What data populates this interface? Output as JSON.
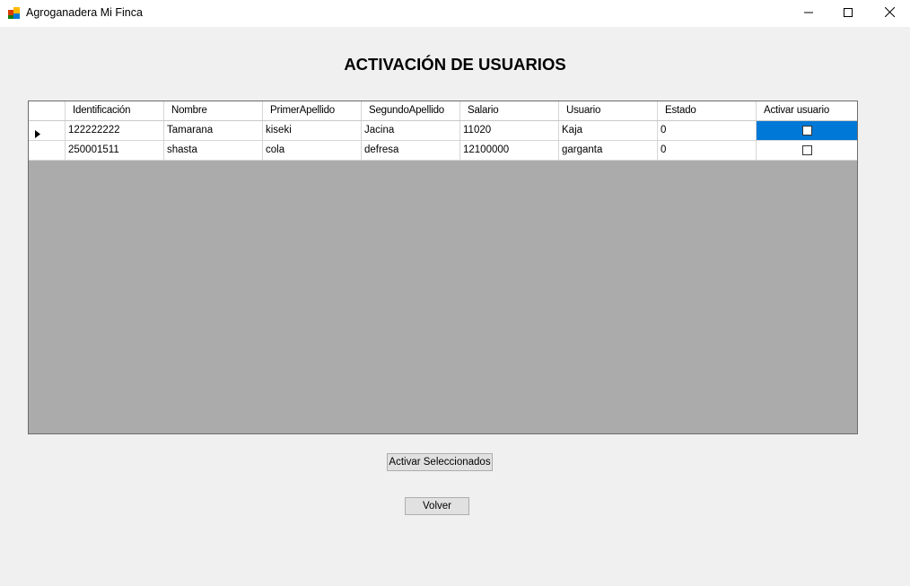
{
  "window": {
    "title": "Agroganadera Mi Finca",
    "controls": {
      "minimize_icon": "minimize-icon",
      "maximize_icon": "maximize-icon",
      "close_icon": "close-icon"
    }
  },
  "page": {
    "heading": "ACTIVACIÓN DE USUARIOS"
  },
  "table": {
    "columns": [
      "Identificación",
      "Nombre",
      "PrimerApellido",
      "SegundoApellido",
      "Salario",
      "Usuario",
      "Estado",
      "Activar usuario"
    ],
    "rows": [
      {
        "identificacion": "122222222",
        "nombre": "Tamarana",
        "primer_apellido": "kiseki",
        "segundo_apellido": "Jacina",
        "salario": "11020",
        "usuario": "Kaja",
        "estado": "0",
        "activar": false,
        "current": true
      },
      {
        "identificacion": "250001511",
        "nombre": "shasta",
        "primer_apellido": "cola",
        "segundo_apellido": "defresa",
        "salario": "12100000",
        "usuario": "garganta",
        "estado": "0",
        "activar": false,
        "current": false
      }
    ],
    "selection_color": "#0078d7"
  },
  "buttons": {
    "activate_selected": "Activar Seleccionados",
    "back": "Volver"
  }
}
